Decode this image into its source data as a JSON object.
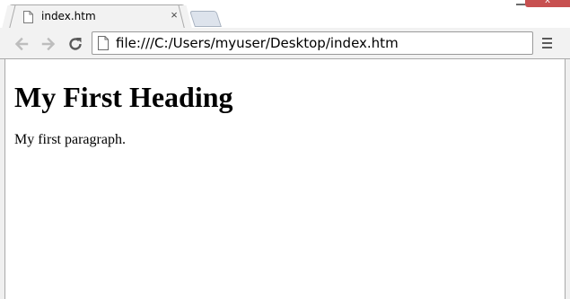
{
  "tab": {
    "title": "index.htm",
    "close_glyph": "×",
    "favicon": "page-icon"
  },
  "toolbar": {
    "back_icon": "back-arrow-icon",
    "forward_icon": "forward-arrow-icon",
    "reload_icon": "reload-icon",
    "url": "file:///C:/Users/myuser/Desktop/index.htm",
    "menu_icon": "hamburger-menu-icon"
  },
  "window_controls": {
    "close_glyph": "x",
    "close_color": "#c75050"
  },
  "page": {
    "heading": "My First Heading",
    "paragraph": "My first paragraph."
  }
}
